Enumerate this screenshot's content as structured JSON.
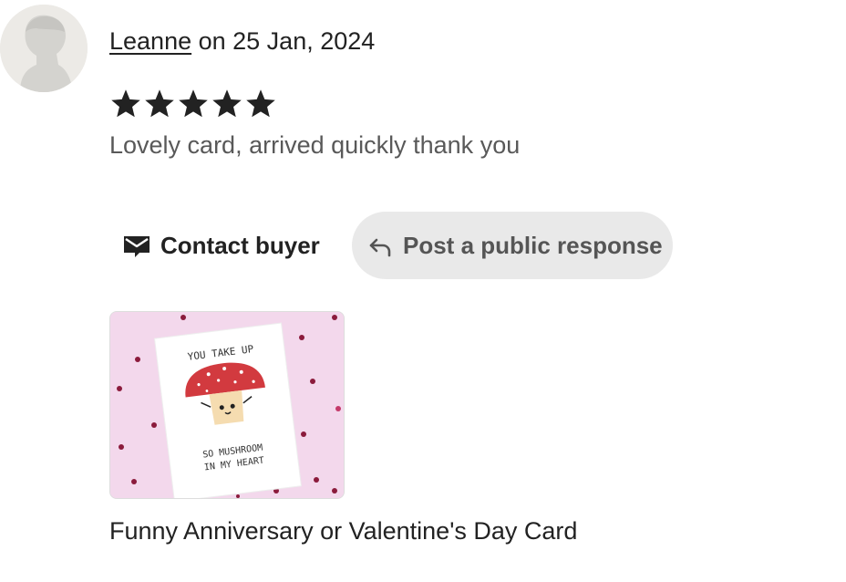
{
  "review": {
    "reviewer_name": "Leanne",
    "date_text": " on 25 Jan, 2024",
    "rating": 5,
    "rating_max": 5,
    "text": "Lovely card, arrived quickly thank you"
  },
  "actions": {
    "contact_label": "Contact buyer",
    "public_response_label": "Post a public response"
  },
  "item": {
    "title": "Funny Anniversary or Valentine's Day Card",
    "card_text_top": "YOU TAKE UP",
    "card_text_bottom_1": "SO MUSHROOM",
    "card_text_bottom_2": "IN MY HEART"
  },
  "colors": {
    "text": "#222222",
    "muted_text": "#595959",
    "button_bg": "#e9e9e9",
    "card_bg": "#f3d8ec",
    "mushroom_red": "#d23a3f"
  },
  "icons": {
    "avatar": "default-avatar-icon",
    "star": "star-icon",
    "contact": "envelope-icon",
    "response": "reply-arrow-icon"
  }
}
